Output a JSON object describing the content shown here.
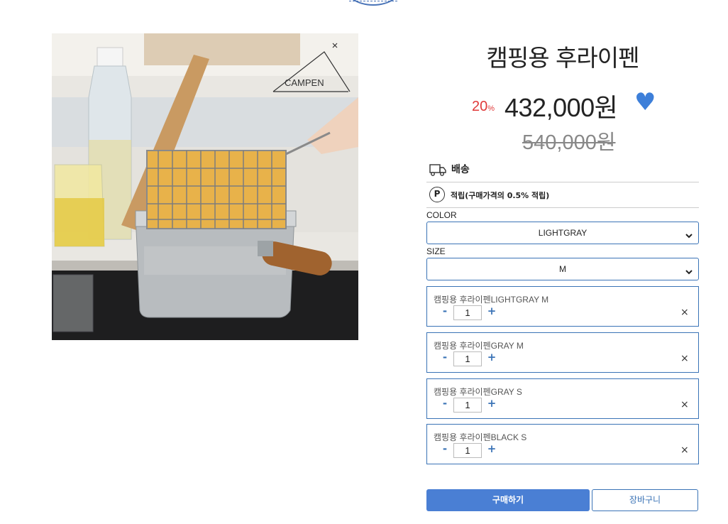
{
  "product": {
    "title": "캠핑용 후라이펜",
    "discount_value": "20",
    "discount_unit": "%",
    "sale_price": "432,000원",
    "original_price": "540,000원",
    "image_logo_text": "CAMPEN"
  },
  "info": {
    "shipping_label": "배송",
    "point_symbol": "P",
    "point_label": "적립(구매가격의 0.5% 적립)"
  },
  "options": {
    "color_label": "COLOR",
    "color_value": "LIGHTGRAY",
    "size_label": "SIZE",
    "size_value": "M"
  },
  "cart_items": [
    {
      "name": "캠핑용 후라이펜LIGHTGRAY M",
      "qty": "1"
    },
    {
      "name": "캠핑용 후라이펜GRAY M",
      "qty": "1"
    },
    {
      "name": "캠핑용 후라이펜GRAY S",
      "qty": "1"
    },
    {
      "name": "캠핑용 후라이펜BLACK S",
      "qty": "1"
    }
  ],
  "controls": {
    "minus": "-",
    "plus": "+",
    "remove": "×"
  },
  "actions": {
    "buy_label": "구매하기",
    "cart_label": "장바구니"
  },
  "icons": {
    "heart": "heart-icon",
    "truck": "truck-icon",
    "point": "point-icon",
    "close": "close-icon"
  },
  "colors": {
    "accent": "#4a7fd4",
    "border": "#3a73b6",
    "discount": "#e03a3a",
    "heart": "#3d7fd9"
  }
}
